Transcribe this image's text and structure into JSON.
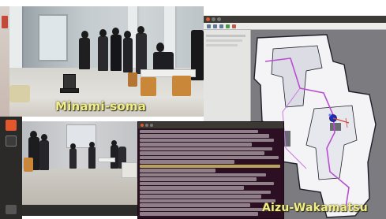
{
  "labels": {
    "site_top": "Minami-soma",
    "site_bottom": "Aizu-Wakamatsu"
  },
  "colors": {
    "overlay_text": "#f2ee8a",
    "terminal_bg": "#2c0f22",
    "terminal_text": "#e7e7e7",
    "terminal_highlight": "#f2f280",
    "map_free_space": "#f4f4f6",
    "map_unknown": "#7c7c80",
    "map_wall": "#1e1e2a",
    "map_path": "#b94fd0",
    "map_robot": "#1f2cb8",
    "dock_bg": "#2b2a29",
    "dock_accent": "#e2572b"
  },
  "icons": {
    "dock": [
      "browser-icon",
      "terminal-icon",
      "rviz-icon"
    ],
    "rviz_toolbar": [
      "move-camera-icon",
      "select-icon",
      "focus-camera-icon",
      "pose-estimate-icon",
      "nav-goal-icon"
    ],
    "window_buttons": [
      "close-icon",
      "minimize-icon",
      "maximize-icon"
    ]
  }
}
